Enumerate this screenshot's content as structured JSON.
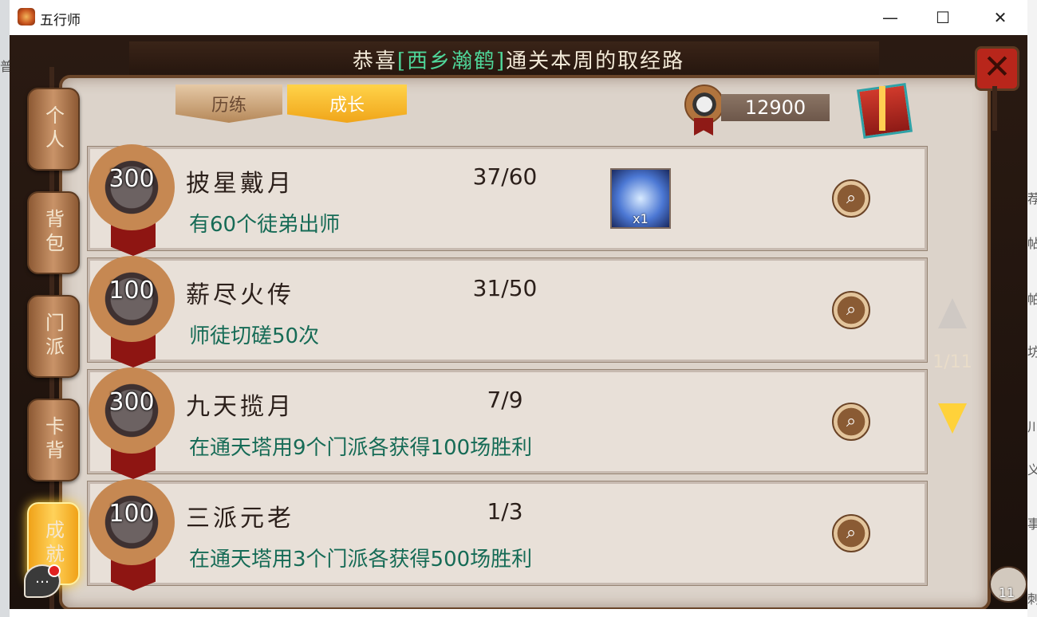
{
  "window": {
    "title": "五行师",
    "minimize_glyph": "—",
    "maximize_glyph": "☐",
    "close_glyph": "✕"
  },
  "background_chars": [
    "普",
    "荐",
    "帖",
    "帕",
    "坊",
    "川",
    "义",
    "事",
    "刺"
  ],
  "banner": {
    "prefix": "恭喜",
    "player": "[西乡瀚鹤]",
    "suffix": "通关本周的取经路"
  },
  "side_tabs": [
    {
      "label": "个人",
      "active": false
    },
    {
      "label": "背包",
      "active": false
    },
    {
      "label": "门派",
      "active": false
    },
    {
      "label": "卡背",
      "active": false
    },
    {
      "label": "成就",
      "active": true
    }
  ],
  "top_tabs": [
    {
      "label": "历练",
      "active": false
    },
    {
      "label": "成长",
      "active": true
    }
  ],
  "currency": {
    "value": "12900",
    "icon": "taiji-coin-icon"
  },
  "achievements": [
    {
      "points": "300",
      "title": "披星戴月",
      "progress": "37/60",
      "desc": "有60个徒弟出师",
      "reward": {
        "icon": "reward-item-icon",
        "count": "x1"
      }
    },
    {
      "points": "100",
      "title": "薪尽火传",
      "progress": "31/50",
      "desc": "师徒切磋50次"
    },
    {
      "points": "300",
      "title": "九天揽月",
      "progress": "7/9",
      "desc": "在通天塔用9个门派各获得100场胜利"
    },
    {
      "points": "100",
      "title": "三派元老",
      "progress": "1/3",
      "desc": "在通天塔用3个门派各获得500场胜利"
    }
  ],
  "pager": {
    "text": "1/11"
  },
  "friends": {
    "count": "11"
  },
  "colors": {
    "accent": "#f0a51a",
    "desc_text": "#166b56",
    "highlight_name": "#4fd79a"
  }
}
